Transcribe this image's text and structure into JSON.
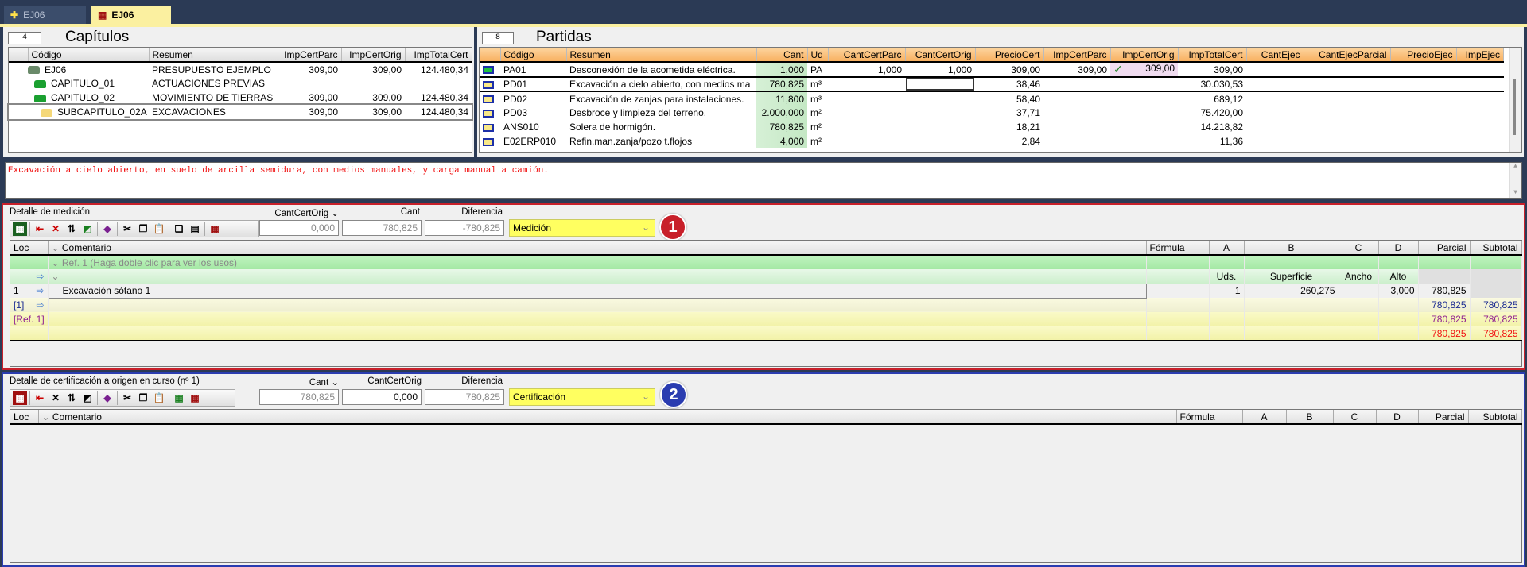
{
  "tabs": [
    {
      "label": "EJ06",
      "active": false
    },
    {
      "label": "EJ06",
      "active": true
    }
  ],
  "capitulos": {
    "count": "4",
    "title": "Capítulos",
    "columns": [
      "Código",
      "Resumen",
      "ImpCertParc",
      "ImpCertOrig",
      "ImpTotalCert"
    ],
    "rows": [
      {
        "level": 0,
        "icon": "budget-icon",
        "code": "EJ06",
        "resumen": "PRESUPUESTO EJEMPLO",
        "imp_cert_parc": "309,00",
        "imp_cert_orig": "309,00",
        "imp_total_cert": "124.480,34"
      },
      {
        "level": 1,
        "icon": "green-folder-icon",
        "code": "CAPITULO_01",
        "resumen": "ACTUACIONES PREVIAS",
        "imp_cert_parc": "",
        "imp_cert_orig": "",
        "imp_total_cert": ""
      },
      {
        "level": 1,
        "icon": "green-folder-icon",
        "code": "CAPITULO_02",
        "resumen": "MOVIMIENTO DE TIERRAS",
        "imp_cert_parc": "309,00",
        "imp_cert_orig": "309,00",
        "imp_total_cert": "124.480,34"
      },
      {
        "level": 2,
        "icon": "yellow-folder-icon",
        "code": "SUBCAPITULO_02A",
        "resumen": "EXCAVACIONES",
        "imp_cert_parc": "309,00",
        "imp_cert_orig": "309,00",
        "imp_total_cert": "124.480,34",
        "selected": true
      }
    ]
  },
  "partidas": {
    "count": "8",
    "title": "Partidas",
    "columns": [
      "Código",
      "Resumen",
      "Cant",
      "Ud",
      "CantCertParc",
      "CantCertOrig",
      "PrecioCert",
      "ImpCertParc",
      "ImpCertOrig",
      "ImpTotalCert",
      "CantEjec",
      "CantEjecParcial",
      "PrecioEjec",
      "ImpEjec"
    ],
    "rows": [
      {
        "status": "green",
        "code": "PA01",
        "resumen": "Desconexión de la acometida eléctrica.",
        "cant": "1,000",
        "ud": "PA",
        "cant_cert_parc": "1,000",
        "cant_cert_orig": "1,000",
        "precio_cert": "309,00",
        "imp_cert_parc": "309,00",
        "imp_cert_orig": "309,00",
        "checked": true,
        "imp_total_cert": "309,00"
      },
      {
        "status": "yellow",
        "code": "PD01",
        "resumen": "Excavación a cielo abierto, con medios ma",
        "cant": "780,825",
        "ud": "m³",
        "cant_cert_parc": "",
        "cant_cert_orig": "",
        "precio_cert": "38,46",
        "imp_cert_parc": "",
        "imp_cert_orig": "",
        "imp_total_cert": "30.030,53",
        "selected": true
      },
      {
        "status": "yellow",
        "code": "PD02",
        "resumen": "Excavación de zanjas para instalaciones.",
        "cant": "11,800",
        "ud": "m³",
        "cant_cert_parc": "",
        "cant_cert_orig": "",
        "precio_cert": "58,40",
        "imp_cert_parc": "",
        "imp_cert_orig": "",
        "imp_total_cert": "689,12"
      },
      {
        "status": "yellow",
        "code": "PD03",
        "resumen": "Desbroce y limpieza del terreno.",
        "cant": "2.000,000",
        "ud": "m²",
        "cant_cert_parc": "",
        "cant_cert_orig": "",
        "precio_cert": "37,71",
        "imp_cert_parc": "",
        "imp_cert_orig": "",
        "imp_total_cert": "75.420,00"
      },
      {
        "status": "yellow",
        "code": "ANS010",
        "resumen": "Solera de hormigón.",
        "cant": "780,825",
        "ud": "m²",
        "cant_cert_parc": "",
        "cant_cert_orig": "",
        "precio_cert": "18,21",
        "imp_cert_parc": "",
        "imp_cert_orig": "",
        "imp_total_cert": "14.218,82"
      },
      {
        "status": "yellow",
        "code": "E02ERP010",
        "resumen": "Refin.man.zanja/pozo t.flojos",
        "cant": "4,000",
        "ud": "m²",
        "cant_cert_parc": "",
        "cant_cert_orig": "",
        "precio_cert": "2,84",
        "imp_cert_parc": "",
        "imp_cert_orig": "",
        "imp_total_cert": "11,36"
      }
    ]
  },
  "description": "Excavación a cielo abierto, en suelo de arcilla semidura, con medios manuales, y carga manual a camión.",
  "medicion": {
    "title": "Detalle de medición",
    "field_labels": [
      "CantCertOrig",
      "Cant",
      "Diferencia"
    ],
    "field_values": [
      "0,000",
      "780,825",
      "-780,825"
    ],
    "mode": "Medición",
    "badge": "1",
    "accent": "#c8202a",
    "columns": [
      "Loc",
      "Comentario",
      "Fórmula",
      "A",
      "B",
      "C",
      "D",
      "Parcial",
      "Subtotal"
    ],
    "ref_row": "Ref. 1 (Haga doble clic para ver los usos)",
    "subheaders": [
      "Uds.",
      "Superficie",
      "Ancho",
      "Alto"
    ],
    "line": {
      "loc": "1",
      "comentario": "Excavación sótano 1",
      "a": "1",
      "b": "260,275",
      "c": "",
      "d": "3,000",
      "parcial": "780,825"
    },
    "sum1": {
      "loc": "[1]",
      "parcial": "780,825",
      "subtotal": "780,825"
    },
    "sum2": {
      "loc": "[Ref. 1]",
      "parcial": "780,825",
      "subtotal": "780,825"
    },
    "sum3": {
      "parcial": "780,825",
      "subtotal": "780,825"
    }
  },
  "certificacion": {
    "title": "Detalle de certificación a origen en curso (nº 1)",
    "field_labels": [
      "Cant",
      "CantCertOrig",
      "Diferencia"
    ],
    "field_values": [
      "780,825",
      "0,000",
      "780,825"
    ],
    "mode": "Certificación",
    "badge": "2",
    "accent": "#2a3cb0",
    "columns": [
      "Loc",
      "Comentario",
      "Fórmula",
      "A",
      "B",
      "C",
      "D",
      "Parcial",
      "Subtotal"
    ]
  }
}
